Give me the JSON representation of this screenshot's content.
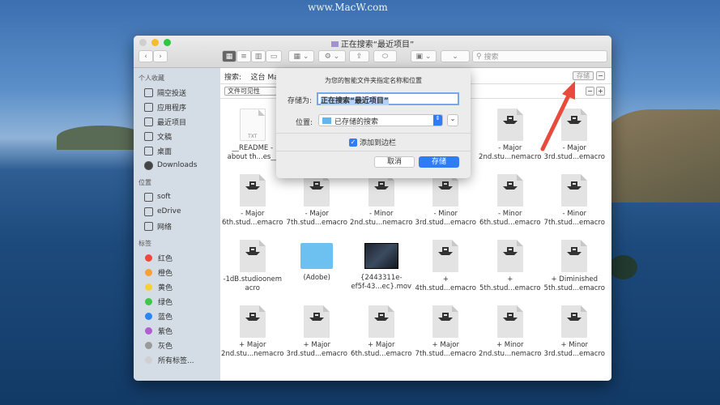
{
  "watermark": "www.MacW.com",
  "window": {
    "title": "正在搜索“最近项目”",
    "search_placeholder": "搜索"
  },
  "sidebar": {
    "sections": [
      {
        "header": "个人收藏",
        "items": [
          {
            "label": "隔空投送",
            "icon": "airdrop-icon"
          },
          {
            "label": "应用程序",
            "icon": "applications-icon"
          },
          {
            "label": "最近项目",
            "icon": "recents-icon"
          },
          {
            "label": "文稿",
            "icon": "documents-icon"
          },
          {
            "label": "桌面",
            "icon": "desktop-icon"
          },
          {
            "label": "Downloads",
            "icon": "downloads-icon"
          }
        ]
      },
      {
        "header": "位置",
        "items": [
          {
            "label": "soft",
            "icon": "disk-icon"
          },
          {
            "label": "eDrive",
            "icon": "disk-icon"
          },
          {
            "label": "网络",
            "icon": "network-icon"
          }
        ]
      },
      {
        "header": "标签",
        "items": [
          {
            "label": "红色",
            "color": "#f0463c"
          },
          {
            "label": "橙色",
            "color": "#f7a033"
          },
          {
            "label": "黄色",
            "color": "#f5d03a"
          },
          {
            "label": "绿色",
            "color": "#3dc74d"
          },
          {
            "label": "蓝色",
            "color": "#2a85f5"
          },
          {
            "label": "紫色",
            "color": "#b05fd0"
          },
          {
            "label": "灰色",
            "color": "#9a9a9a"
          },
          {
            "label": "所有标签...",
            "color": "#d0d0d0"
          }
        ]
      }
    ]
  },
  "searchbar": {
    "label": "搜索:",
    "scope": "这台 Ma",
    "save": "存储",
    "criteria": "文件可见性"
  },
  "dialog": {
    "heading": "为您的智能文件夹指定名称和位置",
    "save_as_label": "存储为:",
    "save_as_value": "正在搜索“最近项目”",
    "location_label": "位置:",
    "location_value": "已存储的搜索",
    "add_sidebar": "添加到边栏",
    "add_sidebar_checked": true,
    "cancel": "取消",
    "save": "存储",
    "accent": "#2f7cf6"
  },
  "files": [
    {
      "type": "txt",
      "l1": "__README -",
      "l2": "about th...es__"
    },
    {
      "type": "hidden"
    },
    {
      "type": "hidden"
    },
    {
      "type": "hidden"
    },
    {
      "type": "macro",
      "l1": "- Major",
      "l2": "2nd.stu...nemacro"
    },
    {
      "type": "macro",
      "l1": "- Major",
      "l2": "3rd.stud...emacro"
    },
    {
      "type": "macro",
      "l1": "- Major",
      "l2": "6th.stud...emacro"
    },
    {
      "type": "macro",
      "l1": "- Major",
      "l2": "7th.stud...emacro"
    },
    {
      "type": "macro",
      "l1": "- Minor",
      "l2": "2nd.stu...nemacro"
    },
    {
      "type": "macro",
      "l1": "- Minor",
      "l2": "3rd.stud...emacro"
    },
    {
      "type": "macro",
      "l1": "- Minor",
      "l2": "6th.stud...emacro"
    },
    {
      "type": "macro",
      "l1": "- Minor",
      "l2": "7th.stud...emacro"
    },
    {
      "type": "macro",
      "l1": "-1dB.studioonem",
      "l2": "acro"
    },
    {
      "type": "folder",
      "l1": "(Adobe)",
      "l2": ""
    },
    {
      "type": "movie",
      "l1": "{2443311e-",
      "l2": "ef5f-43...ec}.mov"
    },
    {
      "type": "macro",
      "l1": "+",
      "l2": "4th.stud...emacro"
    },
    {
      "type": "macro",
      "l1": "+",
      "l2": "5th.stud...emacro"
    },
    {
      "type": "macro",
      "l1": "+ Diminished",
      "l2": "5th.stud...emacro"
    },
    {
      "type": "macro",
      "l1": "+ Major",
      "l2": "2nd.stu...nemacro"
    },
    {
      "type": "macro",
      "l1": "+ Major",
      "l2": "3rd.stud...emacro"
    },
    {
      "type": "macro",
      "l1": "+ Major",
      "l2": "6th.stud...emacro"
    },
    {
      "type": "macro",
      "l1": "+ Major",
      "l2": "7th.stud...emacro"
    },
    {
      "type": "macro",
      "l1": "+ Minor",
      "l2": "2nd.stu...nemacro"
    },
    {
      "type": "macro",
      "l1": "+ Minor",
      "l2": "3rd.stud...emacro"
    }
  ]
}
